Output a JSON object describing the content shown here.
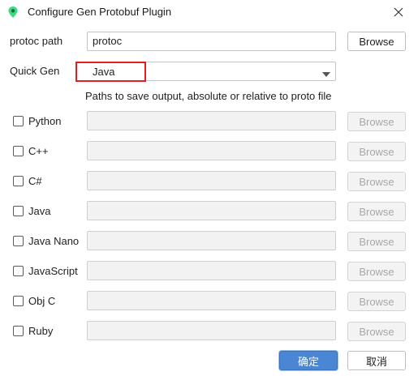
{
  "window": {
    "title": "Configure Gen Protobuf Plugin",
    "icon": "android-pin-icon",
    "close_icon": "close-icon"
  },
  "protoc": {
    "label": "protoc path",
    "value": "protoc",
    "browse_label": "Browse"
  },
  "quick_gen": {
    "label": "Quick Gen",
    "selected": "Java",
    "highlight_color": "#e02020"
  },
  "hint": "Paths to save output, absolute or relative to proto file",
  "languages": [
    {
      "name": "Python",
      "checked": false,
      "path": "",
      "browse_label": "Browse"
    },
    {
      "name": "C++",
      "checked": false,
      "path": "",
      "browse_label": "Browse"
    },
    {
      "name": "C#",
      "checked": false,
      "path": "",
      "browse_label": "Browse"
    },
    {
      "name": "Java",
      "checked": false,
      "path": "",
      "browse_label": "Browse"
    },
    {
      "name": "Java Nano",
      "checked": false,
      "path": "",
      "browse_label": "Browse"
    },
    {
      "name": "JavaScript",
      "checked": false,
      "path": "",
      "browse_label": "Browse"
    },
    {
      "name": "Obj C",
      "checked": false,
      "path": "",
      "browse_label": "Browse"
    },
    {
      "name": "Ruby",
      "checked": false,
      "path": "",
      "browse_label": "Browse"
    }
  ],
  "footer": {
    "ok_label": "确定",
    "cancel_label": "取消",
    "ok_color": "#4a86d4"
  }
}
